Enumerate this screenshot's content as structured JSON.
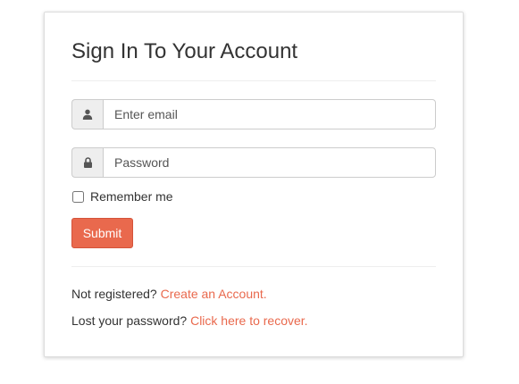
{
  "form": {
    "title": "Sign In To Your Account",
    "email_placeholder": "Enter email",
    "email_icon": "user-icon",
    "password_placeholder": "Password",
    "password_icon": "lock-icon",
    "remember_label": "Remember me",
    "remember_checked": false,
    "submit_label": "Submit"
  },
  "footer": {
    "register_text": "Not registered?",
    "register_link": "Create an Account.",
    "recover_text": "Lost your password?",
    "recover_link": "Click here to recover."
  },
  "colors": {
    "accent": "#e9694d",
    "addon_bg": "#eeeeee",
    "text": "#333333"
  }
}
